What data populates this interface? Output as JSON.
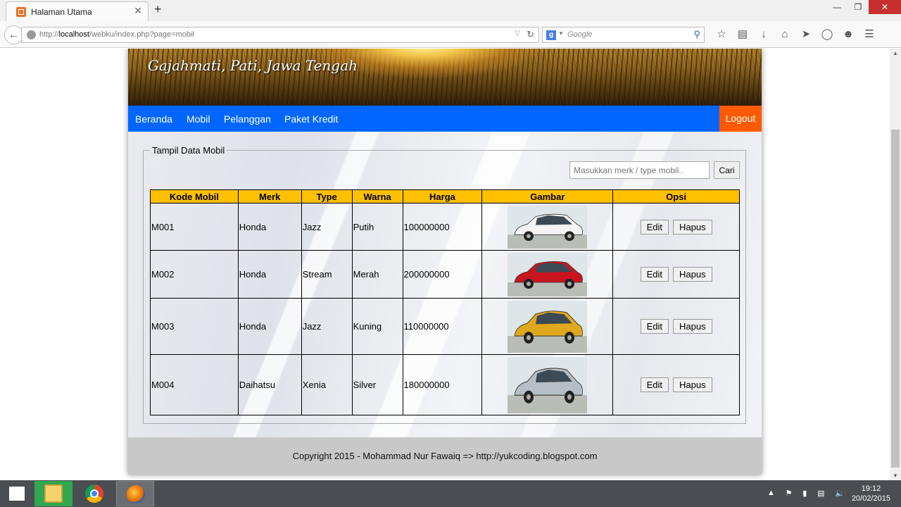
{
  "browser": {
    "tab_title": "Halaman Utama",
    "tab_close": "✕",
    "new_tab": "+",
    "url_prefix": "http://",
    "url_host": "localhost",
    "url_path": "/webku/index.php?page=mobil",
    "search_engine_placeholder": "Google",
    "window_buttons": {
      "minimize": "—",
      "restore": "❐",
      "close": "✕"
    }
  },
  "site": {
    "header_text": "Gajahmati, Pati, Jawa Tengah",
    "menu": [
      "Beranda",
      "Mobil",
      "Pelanggan",
      "Paket Kredit"
    ],
    "logout": "Logout",
    "panel_legend": "Tampil Data Mobil",
    "search_placeholder": "Masukkan merk / type mobil..",
    "search_button": "Cari",
    "footer": "Copyright 2015 - Mohammad Nur Fawaiq => http://yukcoding.blogspot.com"
  },
  "table": {
    "headers": [
      "Kode Mobil",
      "Merk",
      "Type",
      "Warna",
      "Harga",
      "Gambar",
      "Opsi"
    ],
    "edit_label": "Edit",
    "delete_label": "Hapus",
    "rows": [
      {
        "kode": "M001",
        "merk": "Honda",
        "type": "Jazz",
        "warna": "Putih",
        "harga": "100000000",
        "car_color": "#f4f4f4"
      },
      {
        "kode": "M002",
        "merk": "Honda",
        "type": "Stream",
        "warna": "Merah",
        "harga": "200000000",
        "car_color": "#c8141e"
      },
      {
        "kode": "M003",
        "merk": "Honda",
        "type": "Jazz",
        "warna": "Kuning",
        "harga": "110000000",
        "car_color": "#e0a81c"
      },
      {
        "kode": "M004",
        "merk": "Daihatsu",
        "type": "Xenia",
        "warna": "Silver",
        "harga": "180000000",
        "car_color": "#b7bfc6"
      }
    ]
  },
  "taskbar": {
    "time": "19:12",
    "date": "20/02/2015"
  },
  "colors": {
    "menu_bar": "#0066ff",
    "logout": "#ff5a00",
    "table_header": "#ffc000",
    "footer": "#c8c8c8"
  }
}
